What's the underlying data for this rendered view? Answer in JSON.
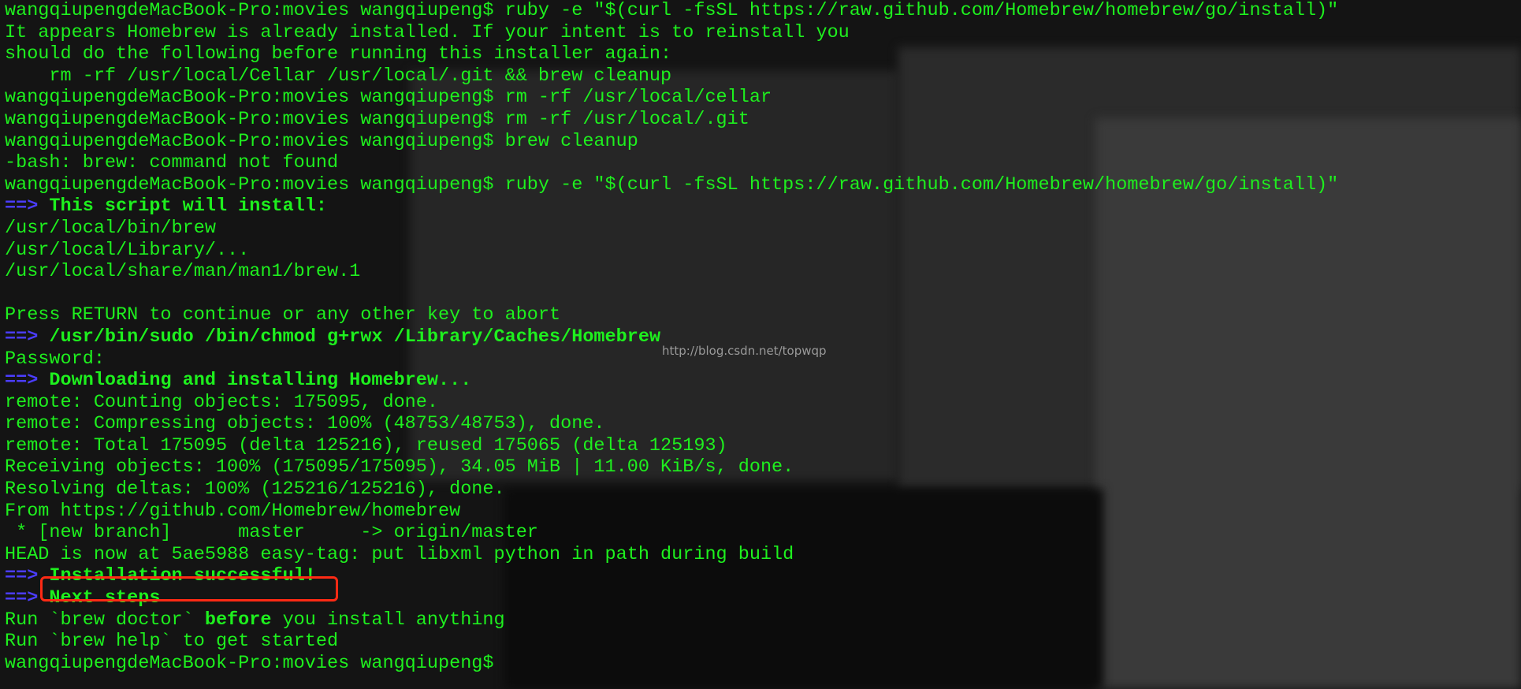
{
  "terminal": {
    "lines": [
      {
        "text": "wangqiupengdeMacBook-Pro:movies wangqiupeng$ ruby -e \"$(curl -fsSL https://raw.github.com/Homebrew/homebrew/go/install)\""
      },
      {
        "text": "It appears Homebrew is already installed. If your intent is to reinstall you"
      },
      {
        "text": "should do the following before running this installer again:"
      },
      {
        "text": "    rm -rf /usr/local/Cellar /usr/local/.git && brew cleanup"
      },
      {
        "text": "wangqiupengdeMacBook-Pro:movies wangqiupeng$ rm -rf /usr/local/cellar"
      },
      {
        "text": "wangqiupengdeMacBook-Pro:movies wangqiupeng$ rm -rf /usr/local/.git"
      },
      {
        "text": "wangqiupengdeMacBook-Pro:movies wangqiupeng$ brew cleanup"
      },
      {
        "text": "-bash: brew: command not found"
      },
      {
        "text": "wangqiupengdeMacBook-Pro:movies wangqiupeng$ ruby -e \"$(curl -fsSL https://raw.github.com/Homebrew/homebrew/go/install)\""
      },
      {
        "arrow": "==>",
        "text": "This script will install:"
      },
      {
        "text": "/usr/local/bin/brew"
      },
      {
        "text": "/usr/local/Library/..."
      },
      {
        "text": "/usr/local/share/man/man1/brew.1"
      },
      {
        "text": ""
      },
      {
        "text": "Press RETURN to continue or any other key to abort"
      },
      {
        "arrow": "==>",
        "text": "/usr/bin/sudo /bin/chmod g+rwx /Library/Caches/Homebrew"
      },
      {
        "text": "Password:"
      },
      {
        "arrow": "==>",
        "text": "Downloading and installing Homebrew..."
      },
      {
        "text": "remote: Counting objects: 175095, done."
      },
      {
        "text": "remote: Compressing objects: 100% (48753/48753), done."
      },
      {
        "text": "remote: Total 175095 (delta 125216), reused 175065 (delta 125193)"
      },
      {
        "text": "Receiving objects: 100% (175095/175095), 34.05 MiB | 11.00 KiB/s, done."
      },
      {
        "text": "Resolving deltas: 100% (125216/125216), done."
      },
      {
        "text": "From https://github.com/Homebrew/homebrew"
      },
      {
        "text": " * [new branch]      master     -> origin/master"
      },
      {
        "text": "HEAD is now at 5ae5988 easy-tag: put libxml python in path during build"
      },
      {
        "arrow": "==>",
        "text": "Installation successful!"
      },
      {
        "arrow": "==>",
        "text": "Next steps"
      },
      {
        "pre": "Run `brew doctor` ",
        "bold": "before",
        "post": " you install anything"
      },
      {
        "text": "Run `brew help` to get started"
      },
      {
        "text": "wangqiupengdeMacBook-Pro:movies wangqiupeng$"
      }
    ]
  },
  "watermark": "http://blog.csdn.net/topwqp",
  "colors": {
    "text": "#1ef01e",
    "arrow": "#4b3dff",
    "highlight": "#ff2a14",
    "background": "#141414"
  }
}
